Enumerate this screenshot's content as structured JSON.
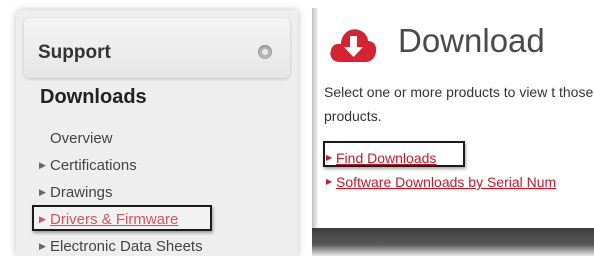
{
  "sidebar": {
    "support_title": "Support",
    "downloads_heading": "Downloads",
    "items": [
      {
        "label": "Overview"
      },
      {
        "label": "Certifications"
      },
      {
        "label": "Drawings"
      },
      {
        "label": "Drivers & Firmware"
      },
      {
        "label": "Electronic Data Sheets"
      }
    ]
  },
  "main": {
    "title": "Download",
    "intro": "Select one or more products to view t those products.",
    "links": [
      {
        "label": "Find Downloads"
      },
      {
        "label": "Software Downloads by Serial Num"
      }
    ]
  },
  "colors": {
    "accent": "#c01b2c",
    "icon": "#d42431"
  },
  "icons": {
    "download": "cloud-download-icon",
    "collapse": "circle-toggle-icon"
  }
}
